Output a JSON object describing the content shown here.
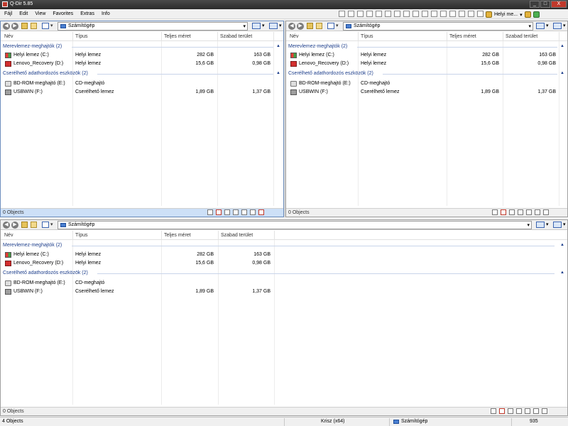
{
  "window": {
    "title": "Q-Dir 5.85",
    "min": "_",
    "max": "□",
    "close": "X"
  },
  "menu": [
    "Fájl",
    "Edit",
    "View",
    "Favorites",
    "Extras",
    "Info"
  ],
  "toolbar": {
    "user": "Helyi me...",
    "drop": "▾"
  },
  "columns": {
    "name": "Név",
    "type": "Típus",
    "total": "Teljes méret",
    "free": "Szabad terület"
  },
  "nav": {
    "back": "◀",
    "forward": "▶",
    "drop": "▾"
  },
  "address": {
    "location": "Számítógép"
  },
  "groups": {
    "local": "Merevlemez-meghajtók (2)",
    "removable": "Cserélhető adathordozós eszközök (2)",
    "chevron": "▲"
  },
  "drives": [
    {
      "name": "Helyi lemez (C:)",
      "type": "Helyi lemez",
      "total": "282 GB",
      "free": "163 GB"
    },
    {
      "name": "Lenovo_Recovery (D:)",
      "type": "Helyi lemez",
      "total": "15,6 GB",
      "free": "0,98 GB"
    },
    {
      "name": "BD-ROM-meghajtó (E:)",
      "type": "CD-meghajtó",
      "total": "",
      "free": ""
    },
    {
      "name": "USBWIN (F:)",
      "type": "Cserélhető lemez",
      "total": "1,89 GB",
      "free": "1,37 GB"
    }
  ],
  "status": {
    "objects": "0 Objects"
  },
  "footer": {
    "objects": "4 Objects",
    "user": "Krisz (x64)",
    "location": "Számítógép",
    "value": "935"
  },
  "colors": {
    "accent": "#1e3f8c",
    "active_status": "#cde0f7",
    "danger": "#c0392b"
  }
}
